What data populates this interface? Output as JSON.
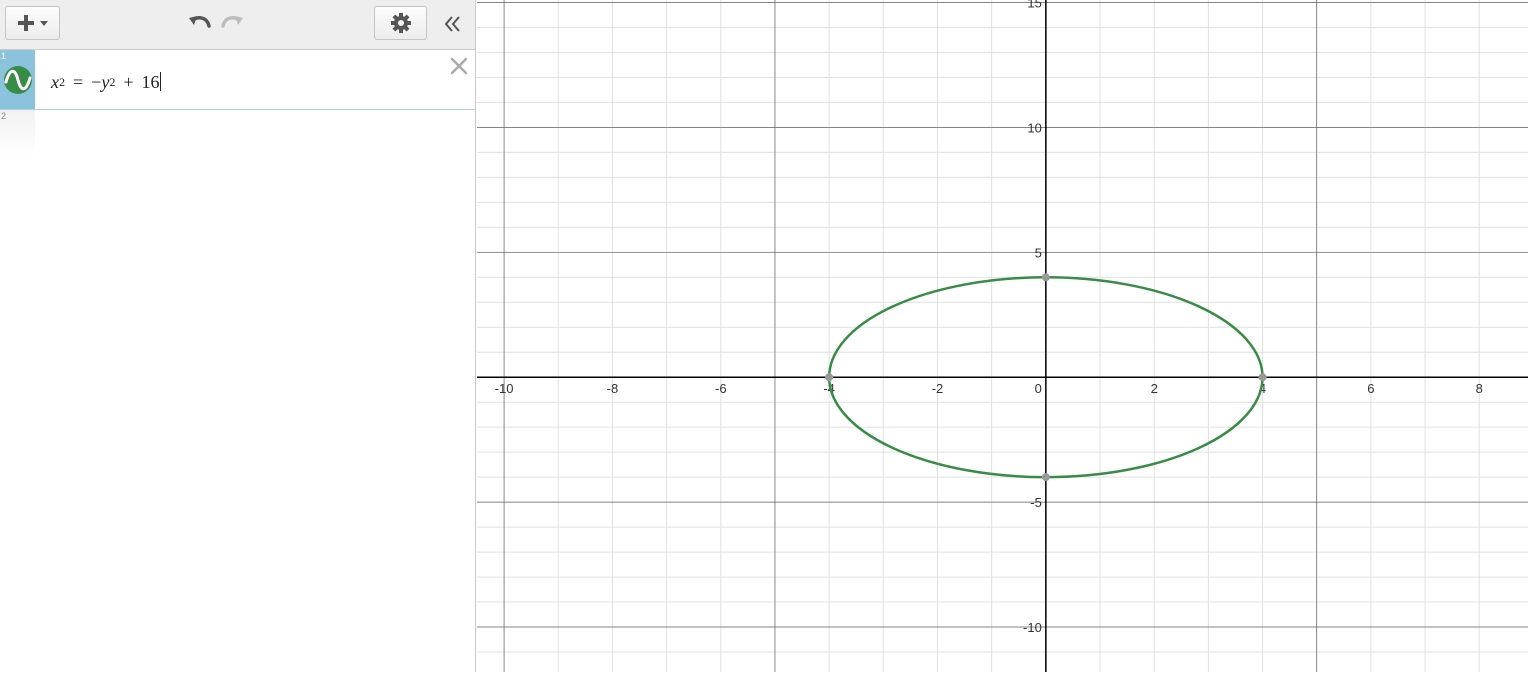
{
  "toolbar": {
    "add_icon": "plus-icon",
    "add_menu_icon": "caret-down-icon",
    "undo_icon": "undo-icon",
    "redo_icon": "redo-icon",
    "settings_icon": "gear-icon",
    "collapse_icon": "double-chevron-left-icon"
  },
  "expressions": [
    {
      "index": "1",
      "lhs_var": "x",
      "lhs_exp": "2",
      "equals": "=",
      "minus": "−",
      "rhs_var": "y",
      "rhs_exp": "2",
      "plus": "+",
      "constant": "16",
      "icon": "sine-wave-icon",
      "color": "#388c46"
    },
    {
      "index": "2"
    }
  ],
  "delete_icon": "close-icon",
  "colors": {
    "curve": "#388c46",
    "expression_tab_active": "#8cc3dc",
    "axis": "#000000",
    "major_grid": "#666666",
    "minor_grid": "#e0e0e0",
    "point": "#999999"
  },
  "chart_data": {
    "type": "line",
    "equation": "x^2 = -y^2 + 16",
    "xlim": [
      -10.5,
      8.9
    ],
    "ylim": [
      -11.8,
      15.1
    ],
    "x_ticks": [
      -10,
      -8,
      -6,
      -4,
      -2,
      0,
      2,
      4,
      6,
      8
    ],
    "y_ticks": [
      -10,
      -5,
      5,
      10,
      15
    ],
    "major_grid_x": [
      -10,
      -5,
      0,
      5
    ],
    "major_grid_y": [
      -10,
      -5,
      0,
      5,
      10,
      15
    ],
    "minor_step": 1,
    "grid": true,
    "series": [
      {
        "shape": "ellipse",
        "center": [
          0,
          0
        ],
        "rx": 4,
        "ry": 4,
        "color": "#388c46"
      }
    ],
    "points": [
      {
        "x": 0,
        "y": 4
      },
      {
        "x": 0,
        "y": -4
      },
      {
        "x": -4,
        "y": 0
      },
      {
        "x": 4,
        "y": 0
      }
    ]
  }
}
